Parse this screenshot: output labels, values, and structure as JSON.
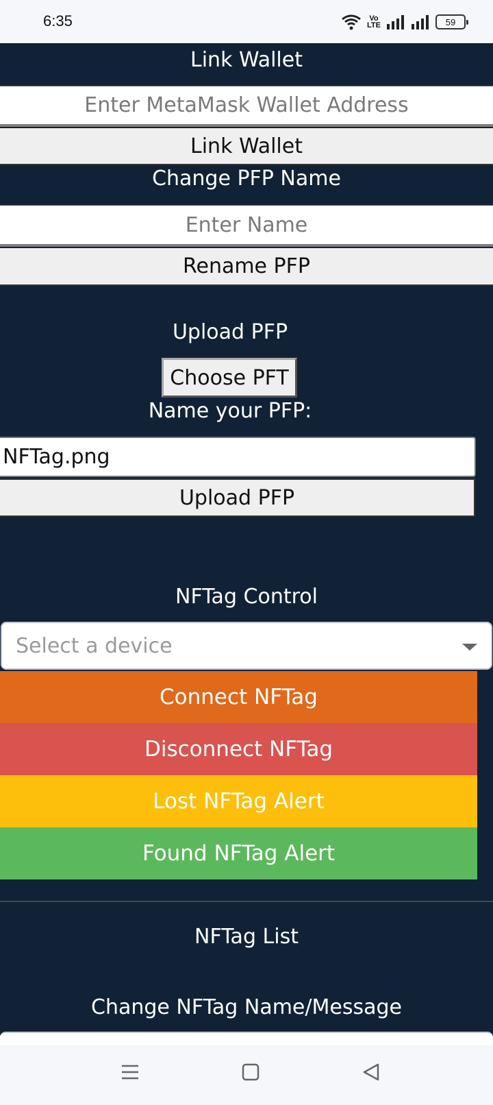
{
  "status_bar": {
    "time": "6:35",
    "volte_top": "Vo",
    "volte_bottom": "LTE",
    "battery": "59"
  },
  "link_wallet": {
    "heading": "Link Wallet",
    "placeholder": "Enter MetaMask Wallet Address",
    "button": "Link Wallet"
  },
  "change_name": {
    "heading": "Change PFP Name",
    "placeholder": "Enter Name",
    "button": "Rename PFP"
  },
  "upload": {
    "heading": "Upload PFP",
    "choose_button": "Choose PFT",
    "name_label": "Name your PFP:",
    "name_value": "NFTag.png",
    "button": "Upload PFP"
  },
  "control": {
    "heading": "NFTag Control",
    "select_placeholder": "Select a device",
    "buttons": [
      {
        "label": "Connect NFTag",
        "color": "#e0691b"
      },
      {
        "label": "Disconnect NFTag",
        "color": "#d9534f"
      },
      {
        "label": "Lost NFTag Alert",
        "color": "#fdbf0b"
      },
      {
        "label": "Found NFTag Alert",
        "color": "#5cb85c"
      }
    ]
  },
  "list": {
    "heading": "NFTag List",
    "change_heading": "Change NFTag Name/Message"
  },
  "nav": {
    "menu_icon": "menu-icon",
    "home_icon": "home-icon",
    "back_icon": "back-icon"
  }
}
